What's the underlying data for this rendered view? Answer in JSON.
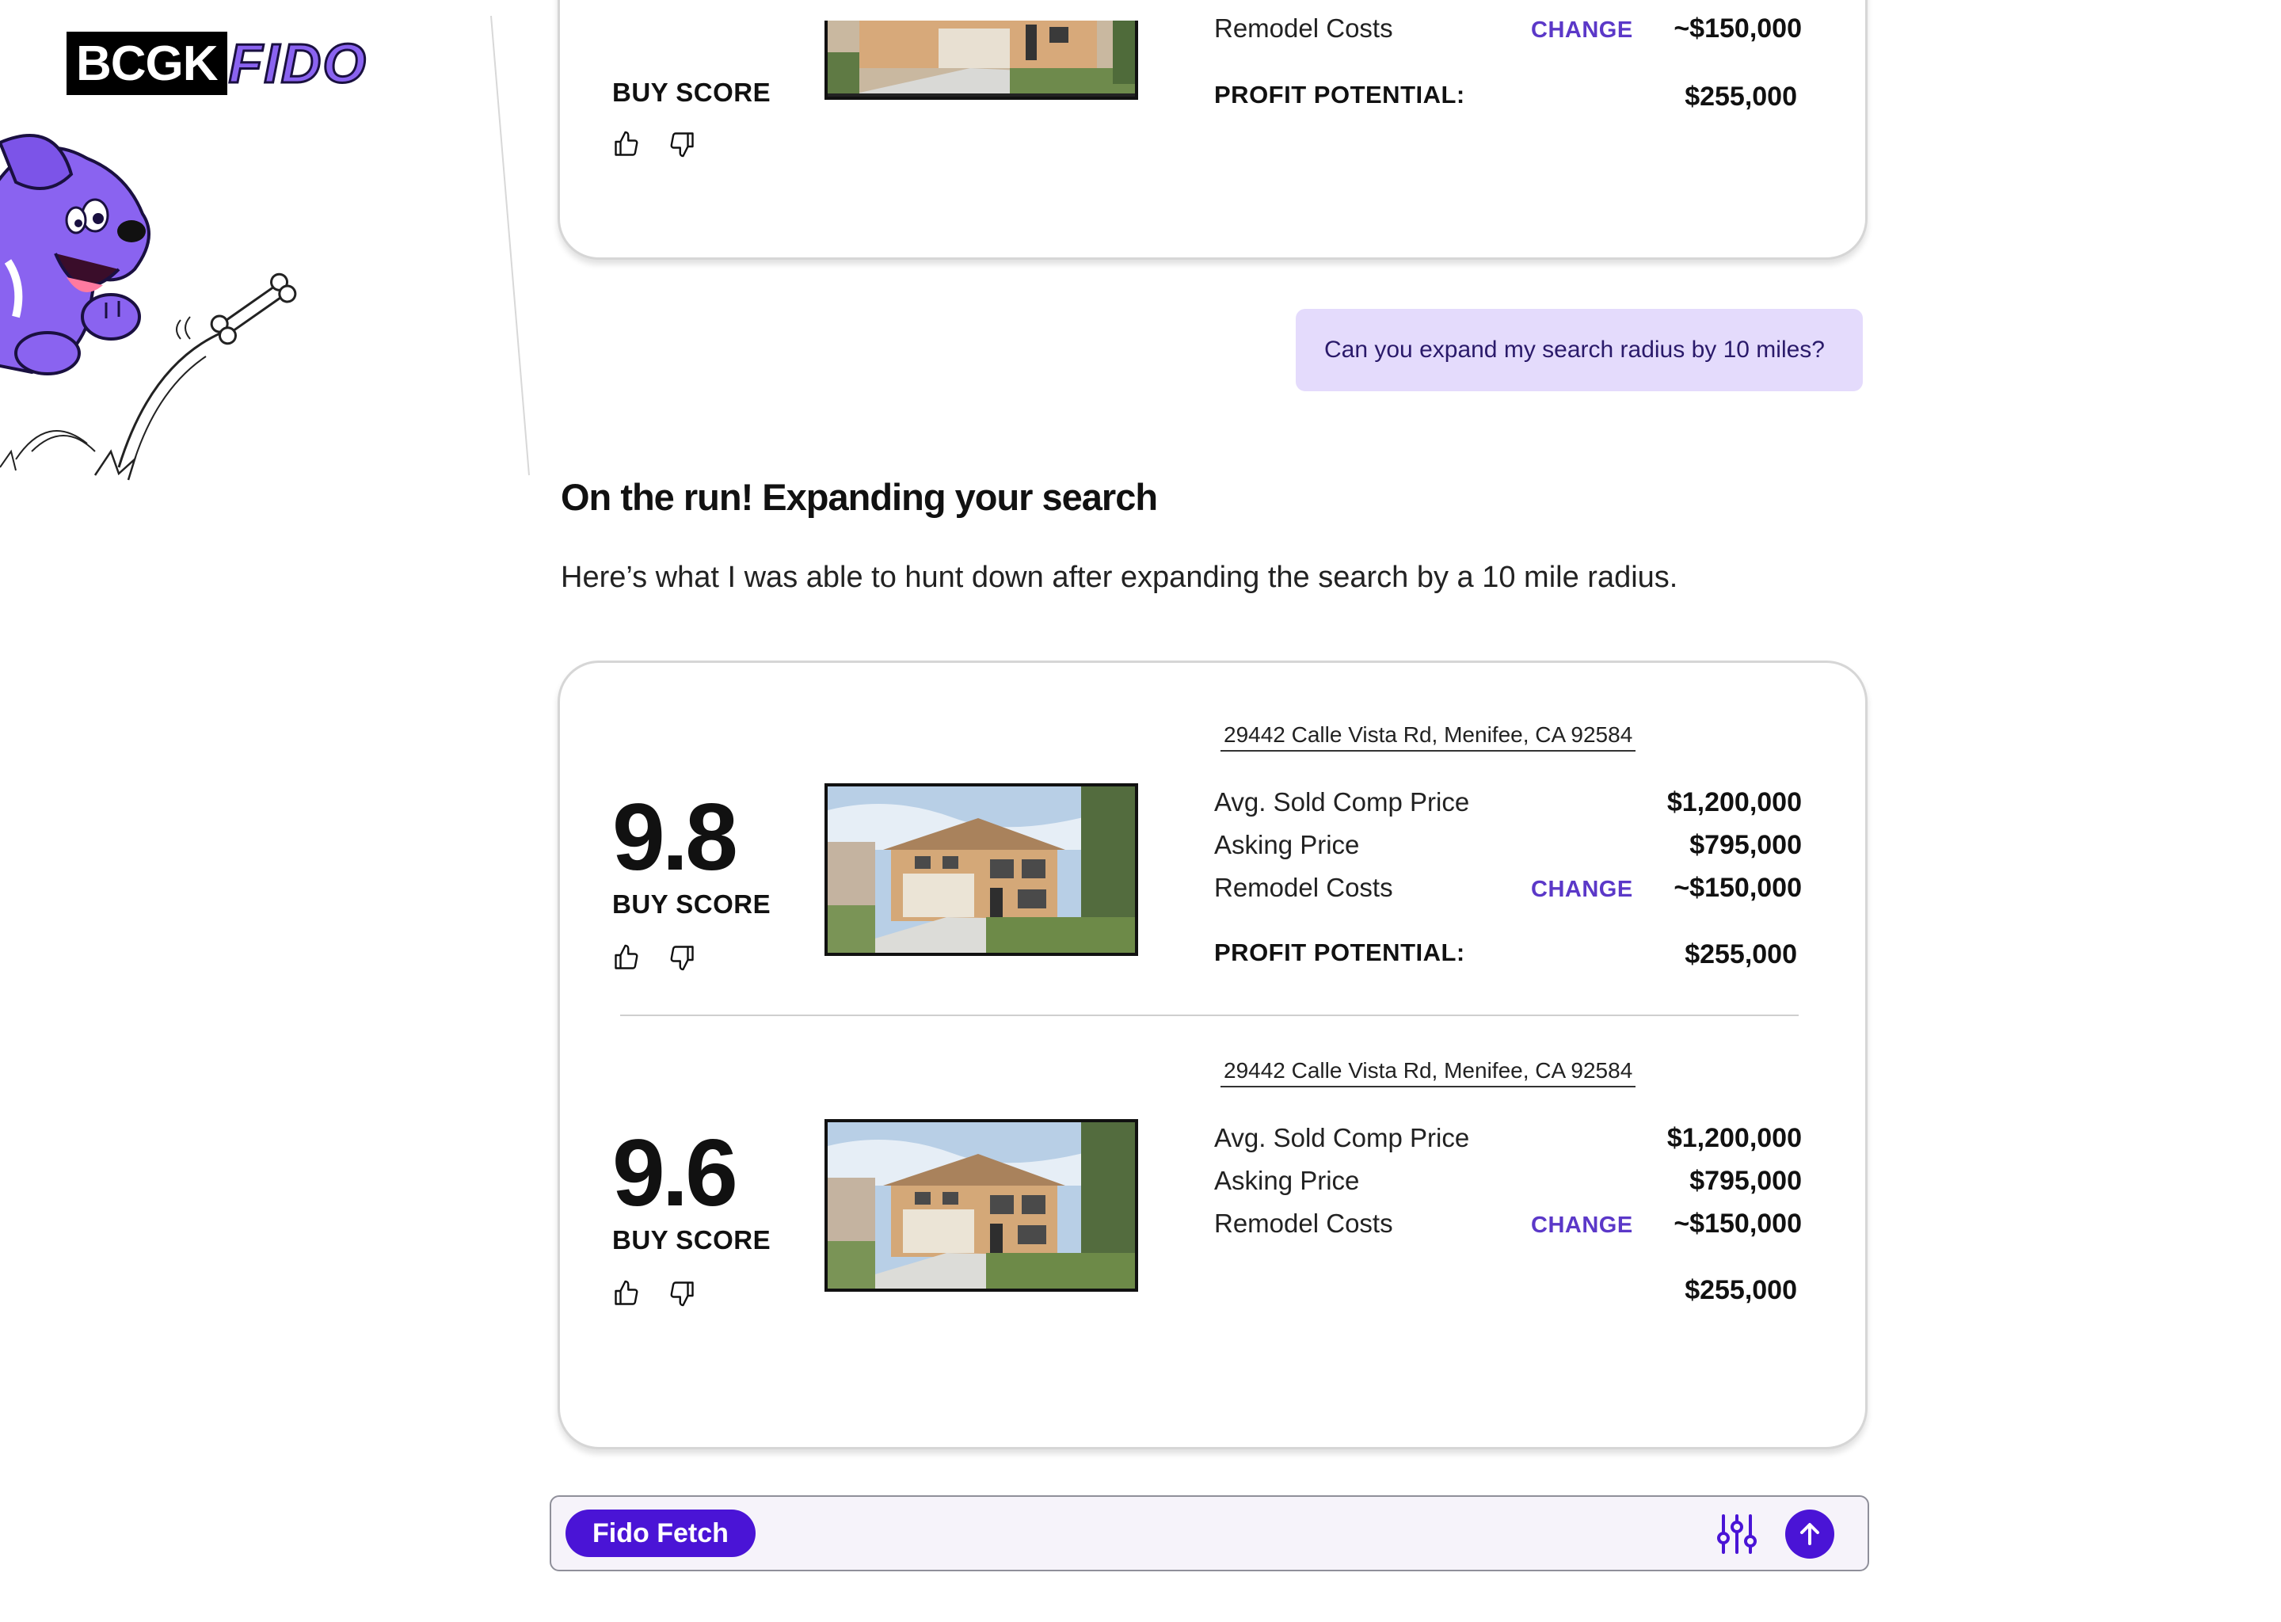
{
  "brand": {
    "logo_left": "BCGK",
    "logo_right": "FIDO",
    "accent": "#4a14d6",
    "purple": "#8a63f0"
  },
  "previous_listing": {
    "score_label": "BUY SCORE",
    "remodel_label": "Remodel Costs",
    "change_label": "CHANGE",
    "remodel_value": "~$150,000",
    "profit_label": "PROFIT POTENTIAL:",
    "profit_value": "$255,000"
  },
  "user_message": "Can you expand my search radius by 10 miles?",
  "response": {
    "title": "On the run! Expanding your search",
    "body": "Here’s what I was able to hunt down after expanding the search by a 10 mile radius."
  },
  "listings": [
    {
      "score": "9.8",
      "score_label": "BUY SCORE",
      "address": "29442 Calle Vista Rd, Menifee, CA 92584",
      "avg_comp_label": "Avg. Sold Comp Price",
      "avg_comp_value": "$1,200,000",
      "asking_label": "Asking Price",
      "asking_value": "$795,000",
      "remodel_label": "Remodel Costs",
      "change_label": "CHANGE",
      "remodel_value": "~$150,000",
      "profit_label": "PROFIT POTENTIAL:",
      "profit_value": "$255,000"
    },
    {
      "score": "9.6",
      "score_label": "BUY SCORE",
      "address": "29442 Calle Vista Rd, Menifee, CA 92584",
      "avg_comp_label": "Avg. Sold Comp Price",
      "avg_comp_value": "$1,200,000",
      "asking_label": "Asking Price",
      "asking_value": "$795,000",
      "remodel_label": "Remodel Costs",
      "change_label": "CHANGE",
      "remodel_value": "~$150,000",
      "profit_value": "$255,000"
    }
  ],
  "composer": {
    "chip_label": "Fido Fetch",
    "icons": [
      "sliders-icon",
      "arrow-up-icon"
    ]
  }
}
